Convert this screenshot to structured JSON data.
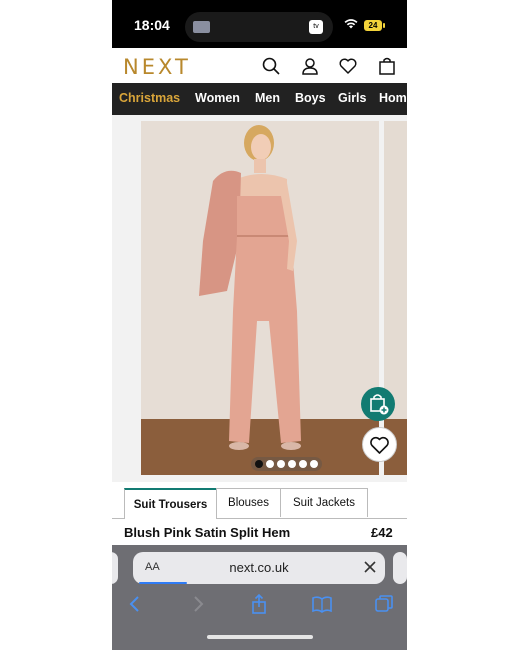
{
  "status": {
    "time": "18:04",
    "battery": "24",
    "island_badge": "tv"
  },
  "header": {
    "logo": "NEXT",
    "icons": [
      "search-icon",
      "account-icon",
      "heart-icon",
      "bag-icon"
    ]
  },
  "nav": {
    "items": [
      "Christmas",
      "Women",
      "Men",
      "Boys",
      "Girls",
      "Hom"
    ]
  },
  "gallery": {
    "image_count": 6,
    "active_index": 0,
    "colors": {
      "accent": "#127b72",
      "brand": "#b8882c"
    }
  },
  "tabs": [
    "Suit Trousers",
    "Blouses",
    "Suit Jackets"
  ],
  "product": {
    "name": "Blush Pink Satin Split Hem",
    "price": "£42"
  },
  "safari": {
    "aa": "AA",
    "url": "next.co.uk"
  }
}
